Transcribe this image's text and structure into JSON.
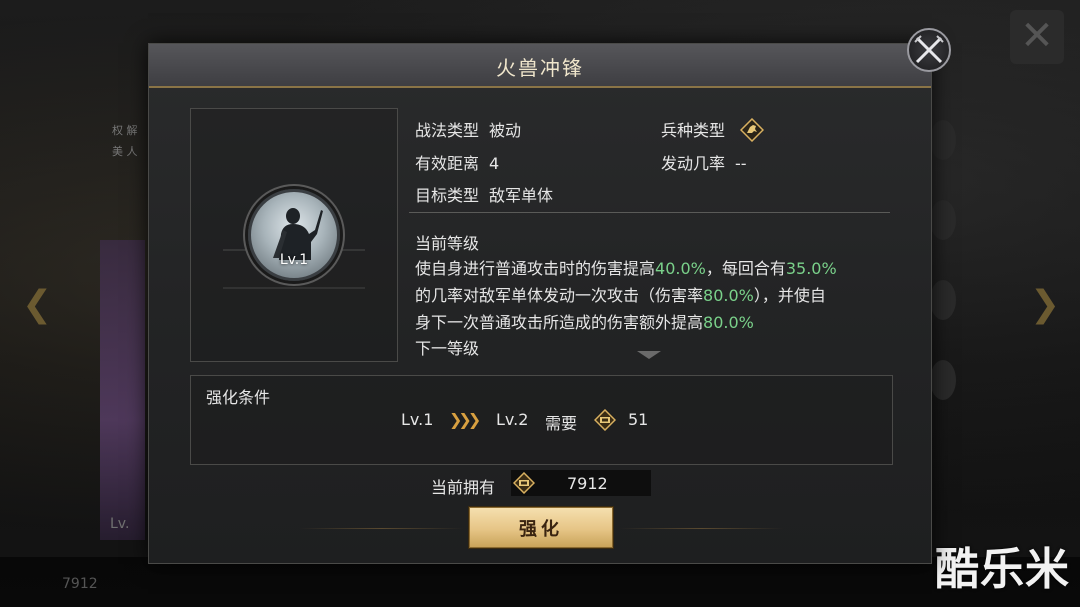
{
  "background": {
    "left_level": "Lv.",
    "bottom_count": "7912",
    "vertical_text": "权 解 美 人"
  },
  "watermark": "酷乐米",
  "dialog": {
    "title": "火兽冲锋"
  },
  "skill": {
    "level": "Lv.1"
  },
  "info": {
    "tactic_type_label": "战法类型",
    "tactic_type_value": "被动",
    "range_label": "有效距离",
    "range_value": "4",
    "target_label": "目标类型",
    "target_value": "敌军单体",
    "troop_label": "兵种类型",
    "trigger_label": "发动几率",
    "trigger_value": "--",
    "troop_icon": "horse-troop-icon"
  },
  "description": {
    "current_title": "当前等级",
    "line1_a": "使自身进行普通攻击时的伤害提高",
    "line1_b": "40.0%",
    "line1_c": "，每回合有",
    "line1_d": "35.0%",
    "line2_a": "的几率对敌军单体发动一次攻击（伤害率",
    "line2_b": "80.0%",
    "line2_c": "），并使自",
    "line3_a": "身下一次普通攻击所造成的伤害额外提高",
    "line3_b": "80.0%",
    "next_title": "下一等级"
  },
  "upgrade": {
    "title": "强化条件",
    "from_level": "Lv.1",
    "to_level": "Lv.2",
    "need_label": "需要",
    "need_value": "51"
  },
  "owned": {
    "label": "当前拥有",
    "value": "7912"
  },
  "enhance_button": "强化",
  "colors": {
    "highlight_green": "#7ad18a",
    "gold": "#e6c586",
    "arrow_orange": "#d8a040"
  }
}
